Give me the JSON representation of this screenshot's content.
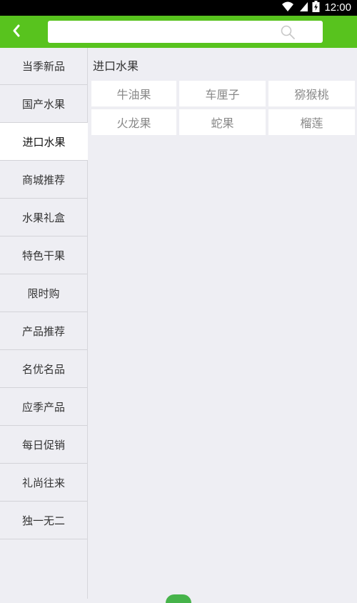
{
  "statusbar": {
    "time": "12:00"
  },
  "search": {
    "value": "",
    "placeholder": ""
  },
  "sidebar": {
    "items": [
      {
        "label": "当季新品"
      },
      {
        "label": "国产水果"
      },
      {
        "label": "进口水果",
        "active": true
      },
      {
        "label": "商城推荐"
      },
      {
        "label": "水果礼盒"
      },
      {
        "label": "特色干果"
      },
      {
        "label": "限时购"
      },
      {
        "label": "产品推荐"
      },
      {
        "label": "名优名品"
      },
      {
        "label": "应季产品"
      },
      {
        "label": "每日促销"
      },
      {
        "label": "礼尚往来"
      },
      {
        "label": "独一无二"
      }
    ]
  },
  "content": {
    "title": "进口水果",
    "items": [
      "牛油果",
      "车厘子",
      "猕猴桃",
      "火龙果",
      "蛇果",
      "榴莲"
    ]
  },
  "colors": {
    "appbar": "#58c31e",
    "active_bg": "#ffffff",
    "page_bg": "#eeeef3"
  },
  "icons": {
    "back": "chevron-left-icon",
    "search": "search-icon",
    "wifi": "wifi-icon",
    "signal": "signal-icon",
    "battery": "battery-icon"
  }
}
